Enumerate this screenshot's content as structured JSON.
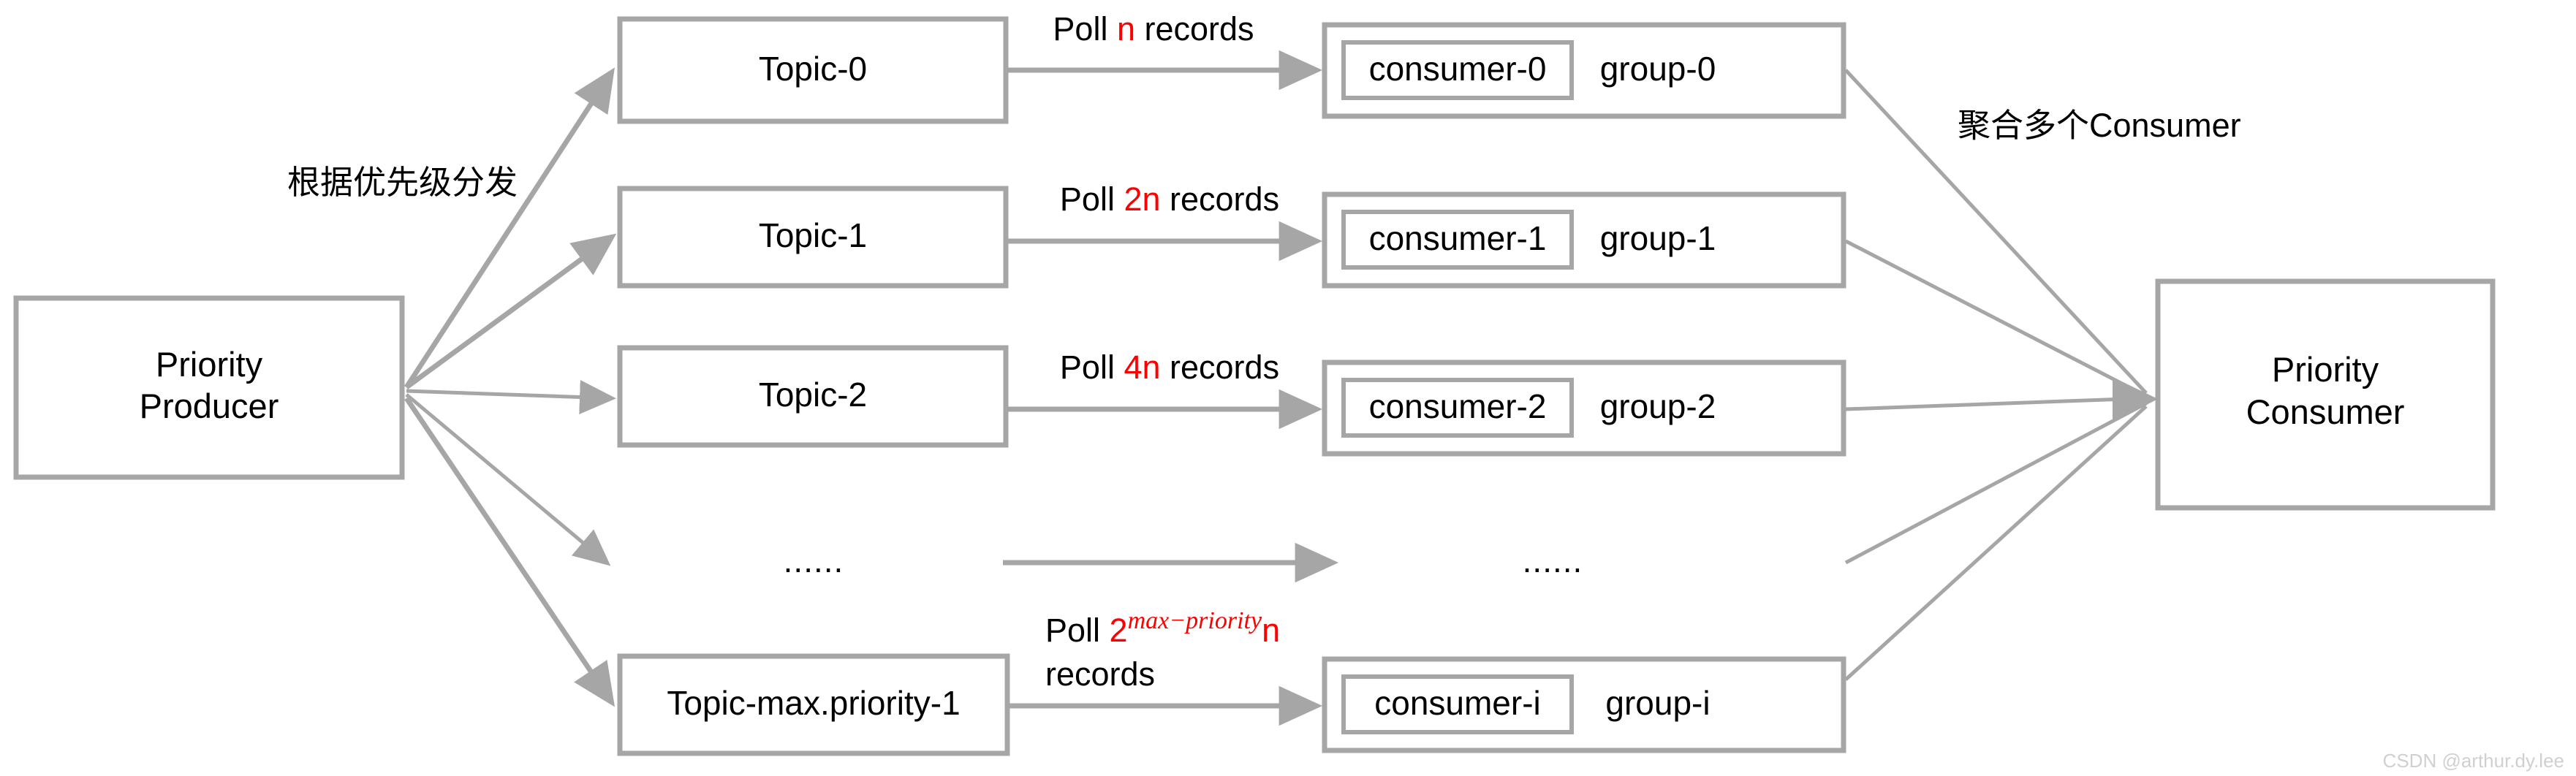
{
  "diagram": {
    "producer": {
      "line1": "Priority",
      "line2": "Producer"
    },
    "consumer": {
      "line1": "Priority",
      "line2": "Consumer"
    },
    "annotations": {
      "dispatch": "根据优先级分发",
      "aggregate": "聚合多个Consumer"
    },
    "topics": [
      {
        "label": "Topic-0"
      },
      {
        "label": "Topic-1"
      },
      {
        "label": "Topic-2"
      },
      {
        "label": "Topic-max.priority-1"
      }
    ],
    "ellipsis_left": "......",
    "ellipsis_right": "......",
    "poll_labels": [
      {
        "prefix": "Poll ",
        "amount": "n",
        "suffix": " records"
      },
      {
        "prefix": "Poll ",
        "amount": "2n",
        "suffix": " records"
      },
      {
        "prefix": "Poll ",
        "amount": "4n",
        "suffix": " records"
      }
    ],
    "poll_formula": {
      "prefix": "Poll ",
      "base": "2",
      "exponent": "max−priority",
      "factor": "n",
      "suffix": "records"
    },
    "consumer_rows": [
      {
        "consumer": "consumer-0",
        "group": "group-0"
      },
      {
        "consumer": "consumer-1",
        "group": "group-1"
      },
      {
        "consumer": "consumer-2",
        "group": "group-2"
      },
      {
        "consumer": "consumer-i",
        "group": "group-i"
      }
    ],
    "watermark": "CSDN @arthur.dy.lee",
    "colors": {
      "stroke": "#a6a6a6",
      "accent": "#ff0000",
      "text": "#000000",
      "background": "#ffffff"
    }
  }
}
